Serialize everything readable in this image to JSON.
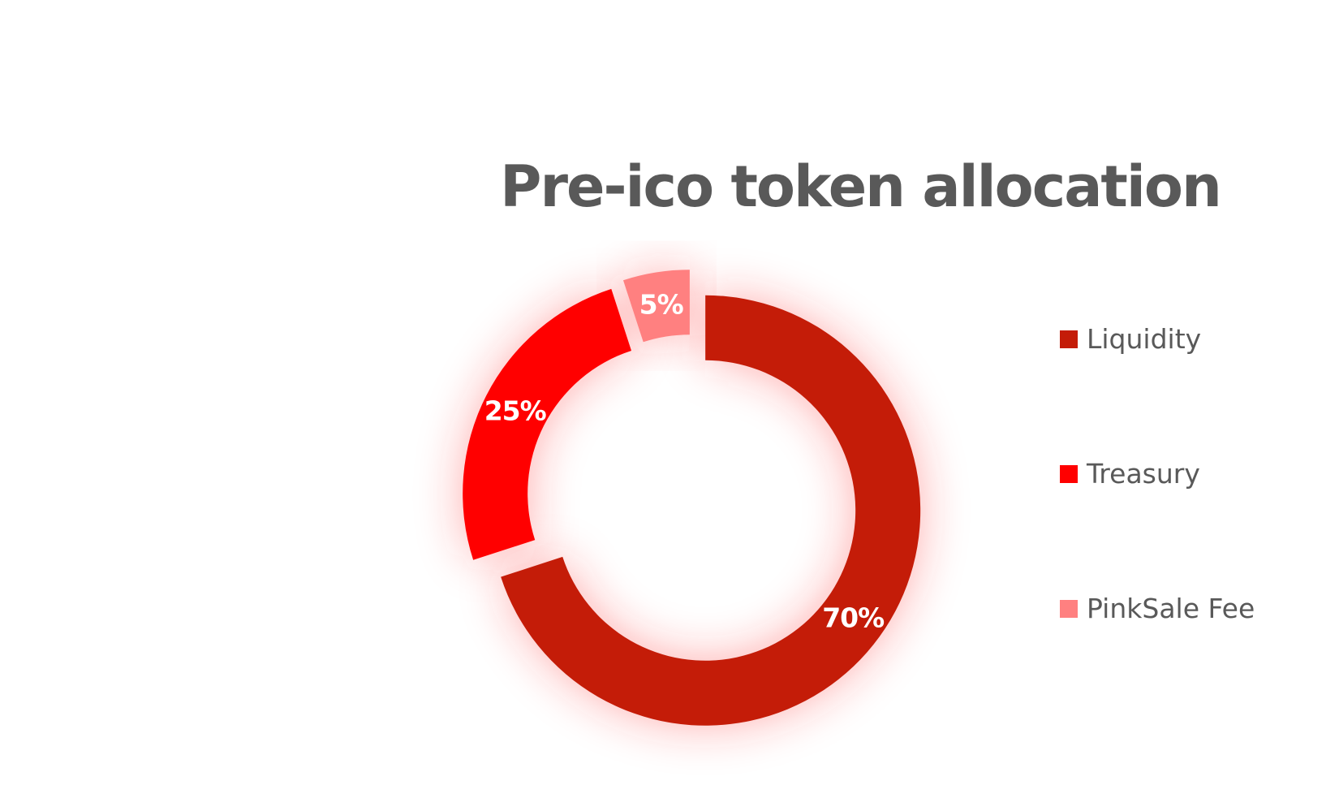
{
  "chart_data": {
    "type": "pie",
    "title": "Pre-ico token allocation",
    "categories": [
      "Liquidity",
      "Treasury",
      "PinkSale Fee"
    ],
    "values": [
      70,
      25,
      5
    ],
    "labels": [
      "70%",
      "25%",
      "5%"
    ],
    "colors": [
      "#c41c08",
      "#ff0000",
      "#ff8080"
    ],
    "style": "doughnut, exploded slices, soft red glow",
    "legend_position": "right"
  }
}
